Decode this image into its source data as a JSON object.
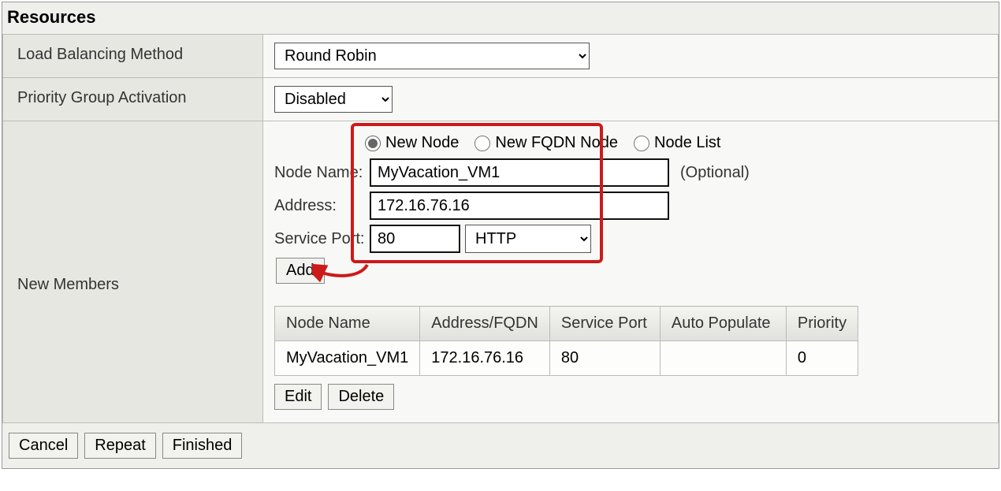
{
  "section_title": "Resources",
  "rows": {
    "lb_method": {
      "label": "Load Balancing Method",
      "value": "Round Robin"
    },
    "pga": {
      "label": "Priority Group Activation",
      "value": "Disabled"
    },
    "members": {
      "label": "New Members",
      "node_type": {
        "opt1": "New Node",
        "opt2": "New FQDN Node",
        "opt3": "Node List",
        "selected": "new_node"
      },
      "node_name": {
        "label": "Node Name:",
        "value": "MyVacation_VM1",
        "suffix": "(Optional)"
      },
      "address": {
        "label": "Address:",
        "value": "172.16.76.16"
      },
      "service_port": {
        "label": "Service Port:",
        "value": "80",
        "type": "HTTP"
      },
      "add_label": "Add"
    }
  },
  "table": {
    "headers": [
      "Node Name",
      "Address/FQDN",
      "Service Port",
      "Auto Populate",
      "Priority"
    ],
    "rows": [
      {
        "name": "MyVacation_VM1",
        "addr": "172.16.76.16",
        "port": "80",
        "auto": "",
        "priority": "0"
      }
    ],
    "edit_label": "Edit",
    "delete_label": "Delete"
  },
  "footer": {
    "cancel": "Cancel",
    "repeat": "Repeat",
    "finished": "Finished"
  }
}
